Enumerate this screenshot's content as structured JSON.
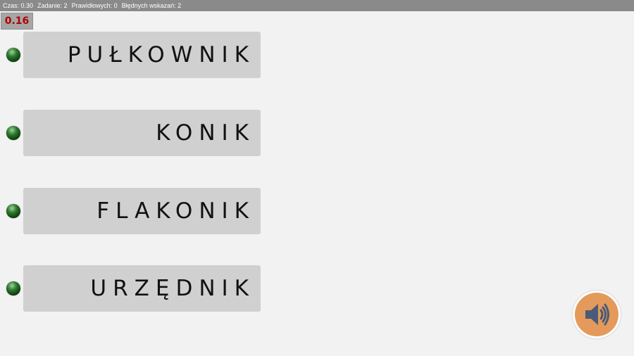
{
  "status": {
    "time": "Czas: 0.30",
    "task": "Zadanie: 2",
    "correct": "Prawidłowych: 0",
    "wrong": "Błędnych wskazań: 2"
  },
  "timer": "0.16",
  "options": [
    {
      "word": "PUŁKOWNIK"
    },
    {
      "word": "KONIK"
    },
    {
      "word": "FLAKONIK"
    },
    {
      "word": "URZĘDNIK"
    }
  ],
  "icons": {
    "option_marker": "green-dot-icon",
    "sound": "speaker-icon"
  },
  "colors": {
    "status_bar": "#8a8a8a",
    "timer_text": "#b00000",
    "card_bg": "#d0d0d0",
    "sound_btn": "#e49a5a",
    "speaker": "#4a5a78"
  }
}
